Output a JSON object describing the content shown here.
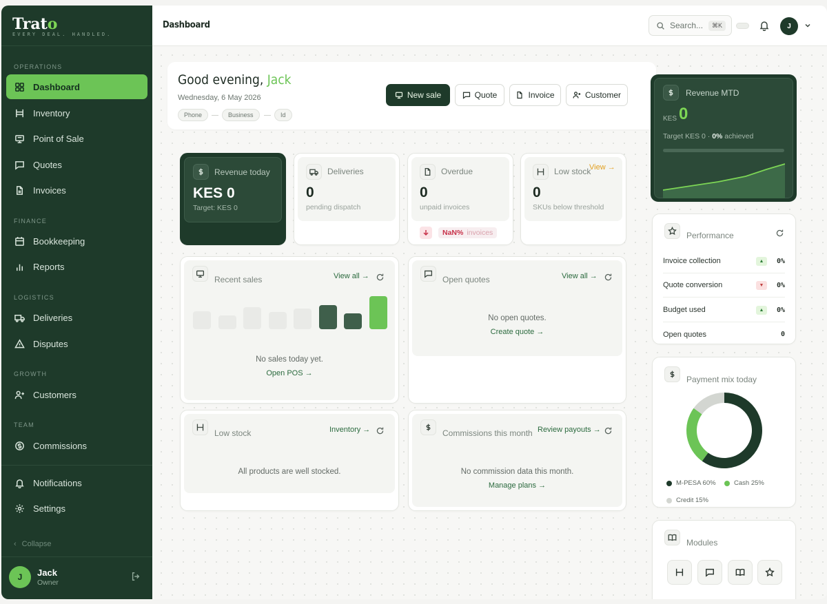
{
  "sidebar": {
    "logo_main": "Trat",
    "logo_accent": "o",
    "tagline": "EVERY DEAL. HANDLED.",
    "sections": [
      "OPERATIONS",
      "FINANCE",
      "LOGISTICS",
      "GROWTH",
      "TEAM"
    ],
    "items": [
      {
        "label": "Dashboard",
        "icon": "grid-icon"
      },
      {
        "label": "Inventory",
        "icon": "shelves-icon"
      },
      {
        "label": "Point of Sale",
        "icon": "register-icon"
      },
      {
        "label": "Quotes",
        "icon": "message-icon"
      },
      {
        "label": "Invoices",
        "icon": "document-icon"
      },
      {
        "label": "Bookkeeping",
        "icon": "calendar-icon"
      },
      {
        "label": "Reports",
        "icon": "bar-chart-icon"
      },
      {
        "label": "Deliveries",
        "icon": "truck-icon"
      },
      {
        "label": "Disputes",
        "icon": "warning-icon"
      },
      {
        "label": "Customers",
        "icon": "user-plus-icon"
      },
      {
        "label": "Commissions",
        "icon": "dollar-circle-icon"
      },
      {
        "label": "Notifications",
        "icon": "bell-icon"
      },
      {
        "label": "Settings",
        "icon": "gear-icon"
      }
    ],
    "collapse_label": "Collapse",
    "user": {
      "initial": "J",
      "name": "Jack",
      "role": "Owner"
    }
  },
  "header": {
    "title": "Dashboard",
    "search_placeholder": "Search...",
    "search_shortcut": "⌘K",
    "avatar_initial": "J"
  },
  "greeting": {
    "prefix": "Good evening, ",
    "name": "Jack",
    "date": "Wednesday, 6 May 2026",
    "chips": [
      "Phone",
      "Business",
      "Id"
    ]
  },
  "actions": {
    "new_sale": "New sale",
    "quote": "Quote",
    "invoice": "Invoice",
    "customer": "Customer"
  },
  "stats": {
    "revenue_today": {
      "label": "Revenue today",
      "value": "KES 0",
      "sub": "Target: KES 0"
    },
    "deliveries": {
      "label": "Deliveries",
      "value": "0",
      "sub": "pending dispatch"
    },
    "overdue": {
      "label": "Overdue",
      "value": "0",
      "sub": "unpaid invoices",
      "badge_value": "NaN%",
      "badge_label": "invoices"
    },
    "low_stock": {
      "label": "Low stock",
      "value": "0",
      "sub": "SKUs below threshold",
      "link": "View →"
    }
  },
  "recent_sales": {
    "title": "Recent sales",
    "link": "View all →",
    "empty": "No sales today yet.",
    "empty_link": "Open POS →",
    "bars": [
      0.55,
      0.42,
      0.67,
      0.52,
      0.62,
      0.72,
      0.47,
      1.0
    ],
    "bar_colors": [
      "#e9eae7",
      "#e9eae7",
      "#e9eae7",
      "#e9eae7",
      "#e9eae7",
      "#3f5f4b",
      "#3f5f4b",
      "#6cc456"
    ]
  },
  "open_quotes": {
    "title": "Open quotes",
    "link": "View all →",
    "empty": "No open quotes.",
    "empty_link": "Create quote →"
  },
  "low_stock_card": {
    "title": "Low stock",
    "link": "Inventory →",
    "empty": "All products are well stocked."
  },
  "commissions": {
    "title": "Commissions this month",
    "link": "Review payouts →",
    "empty": "No commission data this month.",
    "empty_link": "Manage plans →"
  },
  "revenue_mtd": {
    "title": "Revenue MTD",
    "currency": "KES",
    "value": "0",
    "target_prefix": "Target KES 0 · ",
    "target_pct": "0%",
    "target_suffix": " achieved",
    "progress": 0
  },
  "performance": {
    "title": "Performance",
    "rows": [
      {
        "label": "Invoice collection",
        "trend": "up",
        "value": "0%"
      },
      {
        "label": "Quote conversion",
        "trend": "down",
        "value": "0%"
      },
      {
        "label": "Budget used",
        "trend": "up",
        "value": "0%"
      },
      {
        "label": "Open quotes",
        "trend": "",
        "value": "0"
      }
    ]
  },
  "payment_mix": {
    "title": "Payment mix today",
    "chart_data": {
      "type": "pie",
      "categories": [
        "M-PESA",
        "Cash",
        "Credit"
      ],
      "values": [
        60,
        25,
        15
      ],
      "colors": [
        "#1e3a2a",
        "#6cc456",
        "#d3d6d1"
      ]
    },
    "legend": [
      "M-PESA 60%",
      "Cash 25%",
      "Credit 15%"
    ]
  },
  "modules": {
    "title": "Modules",
    "icons": [
      "shelves-icon",
      "message-icon",
      "book-icon",
      "star-icon"
    ]
  },
  "colors": {
    "brand_dark": "#1e3a2a",
    "accent": "#6cc456",
    "warning": "#e2a020",
    "danger": "#c8324a"
  }
}
